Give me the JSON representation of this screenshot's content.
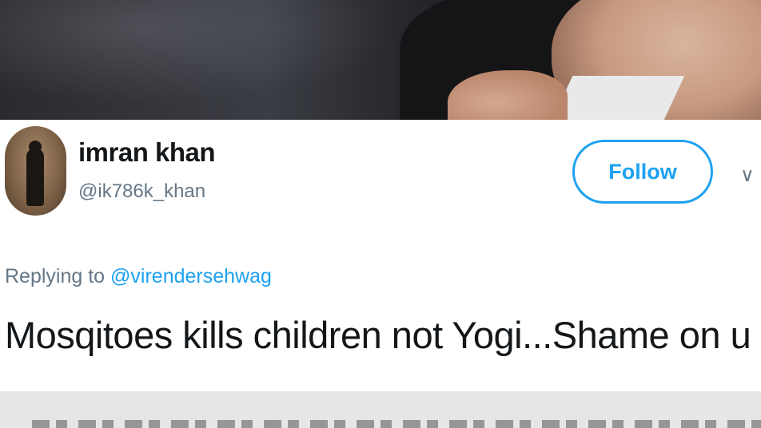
{
  "tweet": {
    "display_name": "imran khan",
    "handle": "@ik786k_khan",
    "follow_label": "Follow",
    "chevron": "∨",
    "replying_prefix": "Replying to",
    "replying_to": "@virendersehwag",
    "text": "Mosqitoes kills children not Yogi...Shame on u"
  },
  "colors": {
    "accent": "#1da1f2",
    "text": "#14171a",
    "muted": "#657786"
  },
  "icons": {
    "more": "chevron-down-icon"
  }
}
